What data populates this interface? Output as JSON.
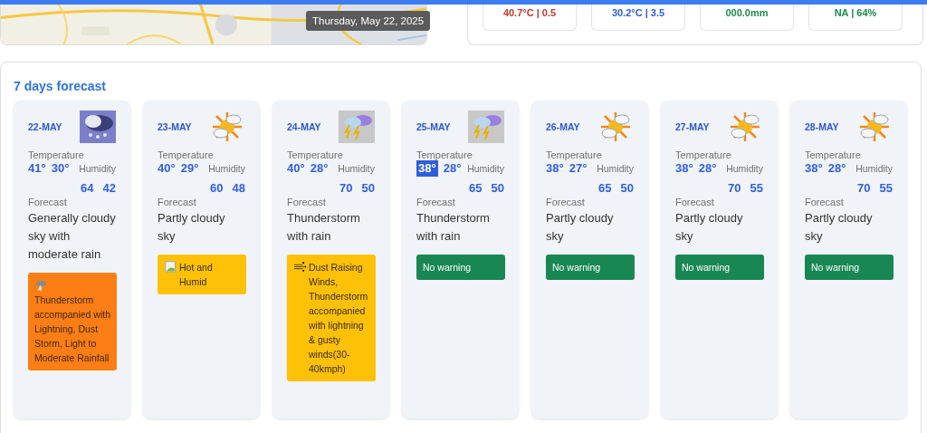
{
  "map": {
    "kind": "picture",
    "tooltip": "Thursday, May 22, 2025"
  },
  "stats": [
    {
      "value": "40.7°C | 0.5",
      "color": "#c0392b"
    },
    {
      "value": "30.2°C | 3.5",
      "color": "#2e5bd8"
    },
    {
      "value": "000.0mm",
      "color": "#1e8a4c"
    },
    {
      "value": "NA | 64%",
      "color": "#1e8a4c"
    }
  ],
  "forecast": {
    "title": "7 days forecast",
    "days": [
      {
        "date": "22-MAY",
        "kind": "rain",
        "temperature_label": "Temperature",
        "max": "41°",
        "min": "30°",
        "max_highlighted": false,
        "humidity_label": "Humidity",
        "humidity_max": "64",
        "humidity_min": "42",
        "forecast_label": "Forecast",
        "forecast": "Generally cloudy sky with moderate rain",
        "warning": {
          "kind": "storm",
          "text": "Thunderstorm accompanied with Lightning, Dust Storm, Light to Moderate Rainfall",
          "color": "#fd7e14"
        }
      },
      {
        "date": "23-MAY",
        "kind": "partly-cloudy",
        "temperature_label": "Temperature",
        "max": "40°",
        "min": "29°",
        "max_highlighted": false,
        "humidity_label": "Humidity",
        "humidity_max": "60",
        "humidity_min": "48",
        "forecast_label": "Forecast",
        "forecast": "Partly cloudy sky",
        "warning": {
          "kind": "broken-image",
          "text": "Hot and Humid",
          "color": "#ffc107"
        }
      },
      {
        "date": "24-MAY",
        "kind": "thunderstorm",
        "temperature_label": "Temperature",
        "max": "40°",
        "min": "28°",
        "max_highlighted": false,
        "humidity_label": "Humidity",
        "humidity_max": "70",
        "humidity_min": "50",
        "forecast_label": "Forecast",
        "forecast": "Thunderstorm with rain",
        "warning": {
          "kind": "wind",
          "text": "Dust Raising Winds, Thunderstorm accompanied with lightning & gusty winds(30-40kmph)",
          "color": "#ffc107"
        }
      },
      {
        "date": "25-MAY",
        "kind": "thunderstorm",
        "temperature_label": "Temperature",
        "max": "38°",
        "min": "28°",
        "max_highlighted": true,
        "humidity_label": "Humidity",
        "humidity_max": "65",
        "humidity_min": "50",
        "forecast_label": "Forecast",
        "forecast": "Thunderstorm with rain",
        "warning": {
          "text": "No warning",
          "color": "#198754"
        }
      },
      {
        "date": "26-MAY",
        "kind": "partly-cloudy",
        "temperature_label": "Temperature",
        "max": "38°",
        "min": "27°",
        "max_highlighted": false,
        "humidity_label": "Humidity",
        "humidity_max": "65",
        "humidity_min": "50",
        "forecast_label": "Forecast",
        "forecast": "Partly cloudy sky",
        "warning": {
          "text": "No warning",
          "color": "#198754"
        }
      },
      {
        "date": "27-MAY",
        "kind": "partly-cloudy",
        "temperature_label": "Temperature",
        "max": "38°",
        "min": "28°",
        "max_highlighted": false,
        "humidity_label": "Humidity",
        "humidity_max": "70",
        "humidity_min": "55",
        "forecast_label": "Forecast",
        "forecast": "Partly cloudy sky",
        "warning": {
          "text": "No warning",
          "color": "#198754"
        }
      },
      {
        "date": "28-MAY",
        "kind": "partly-cloudy",
        "temperature_label": "Temperature",
        "max": "38°",
        "min": "28°",
        "max_highlighted": false,
        "humidity_label": "Humidity",
        "humidity_max": "70",
        "humidity_min": "55",
        "forecast_label": "Forecast",
        "forecast": "Partly cloudy sky",
        "warning": {
          "text": "No warning",
          "color": "#198754"
        }
      }
    ]
  }
}
